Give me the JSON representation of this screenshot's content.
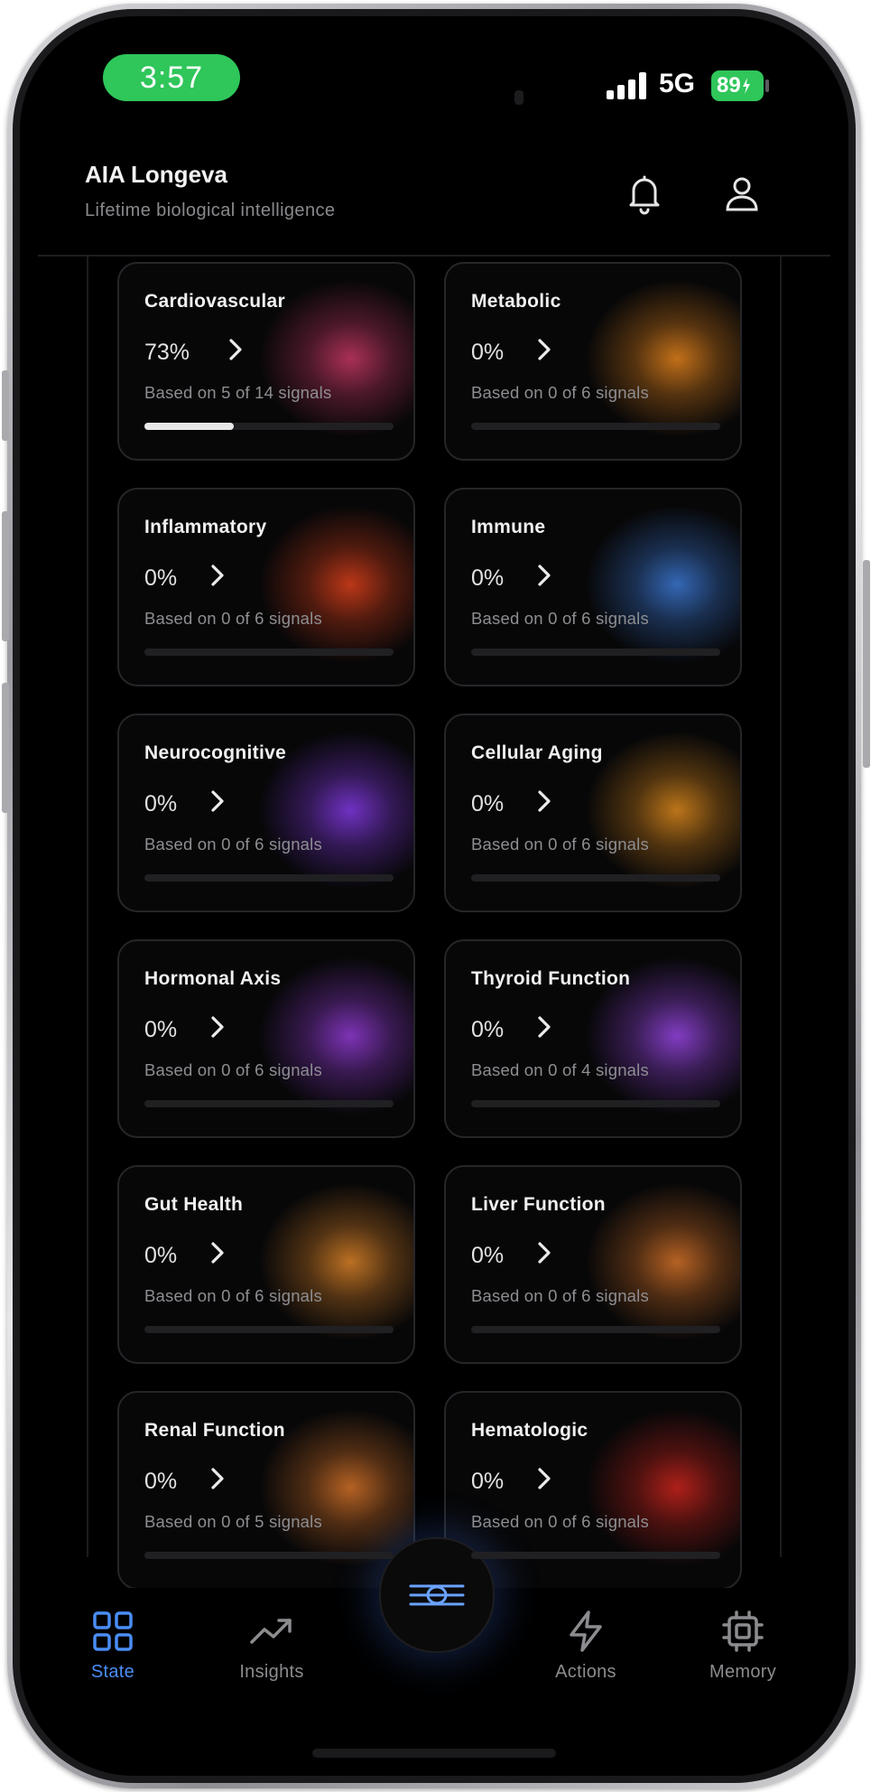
{
  "status_bar": {
    "time": "3:57",
    "network": "5G",
    "battery": "89"
  },
  "header": {
    "title": "AIA Longeva",
    "subtitle": "Lifetime biological intelligence"
  },
  "cards": [
    {
      "name": "Cardiovascular",
      "percent": "73%",
      "signals_text": "Based on 5 of 14 signals",
      "progress": 0.36,
      "accent": "#d23a6a",
      "icon": "heart-image"
    },
    {
      "name": "Metabolic",
      "percent": "0%",
      "signals_text": "Based on 0 of 6 signals",
      "progress": 0,
      "accent": "#f08a1e",
      "icon": "pancreas-image"
    },
    {
      "name": "Inflammatory",
      "percent": "0%",
      "signals_text": "Based on 0 of 6 signals",
      "progress": 0,
      "accent": "#e8431c",
      "icon": "inflamed-tissue-image"
    },
    {
      "name": "Immune",
      "percent": "0%",
      "signals_text": "Based on 0 of 6 signals",
      "progress": 0,
      "accent": "#3f7fe0",
      "icon": "immune-cell-image"
    },
    {
      "name": "Neurocognitive",
      "percent": "0%",
      "signals_text": "Based on 0 of 6 signals",
      "progress": 0,
      "accent": "#8a3cf0",
      "icon": "neuron-image"
    },
    {
      "name": "Cellular Aging",
      "percent": "0%",
      "signals_text": "Based on 0 of 6 signals",
      "progress": 0,
      "accent": "#e8901e",
      "icon": "cell-image"
    },
    {
      "name": "Hormonal Axis",
      "percent": "0%",
      "signals_text": "Based on 0 of 6 signals",
      "progress": 0,
      "accent": "#9a3ee0",
      "icon": "endocrine-image"
    },
    {
      "name": "Thyroid Function",
      "percent": "0%",
      "signals_text": "Based on 0 of 4 signals",
      "progress": 0,
      "accent": "#a04af0",
      "icon": "thyroid-image"
    },
    {
      "name": "Gut Health",
      "percent": "0%",
      "signals_text": "Based on 0 of 6 signals",
      "progress": 0,
      "accent": "#e88a2a",
      "icon": "intestine-image"
    },
    {
      "name": "Liver Function",
      "percent": "0%",
      "signals_text": "Based on 0 of 6 signals",
      "progress": 0,
      "accent": "#e0782a",
      "icon": "liver-image"
    },
    {
      "name": "Renal Function",
      "percent": "0%",
      "signals_text": "Based on 0 of 5 signals",
      "progress": 0,
      "accent": "#e0782a",
      "icon": "kidney-image"
    },
    {
      "name": "Hematologic",
      "percent": "0%",
      "signals_text": "Based on 0 of 6 signals",
      "progress": 0,
      "accent": "#d8261e",
      "icon": "blood-cells-image"
    }
  ],
  "nav": [
    {
      "label": "State",
      "icon": "grid-icon",
      "active": true
    },
    {
      "label": "Insights",
      "icon": "trend-icon",
      "active": false
    },
    {
      "label": "Actions",
      "icon": "lightning-icon",
      "active": false
    },
    {
      "label": "Memory",
      "icon": "chip-icon",
      "active": false
    }
  ],
  "colors": {
    "accent": "#4a8df5",
    "time_pill": "#2fc65a",
    "background": "#000000"
  }
}
